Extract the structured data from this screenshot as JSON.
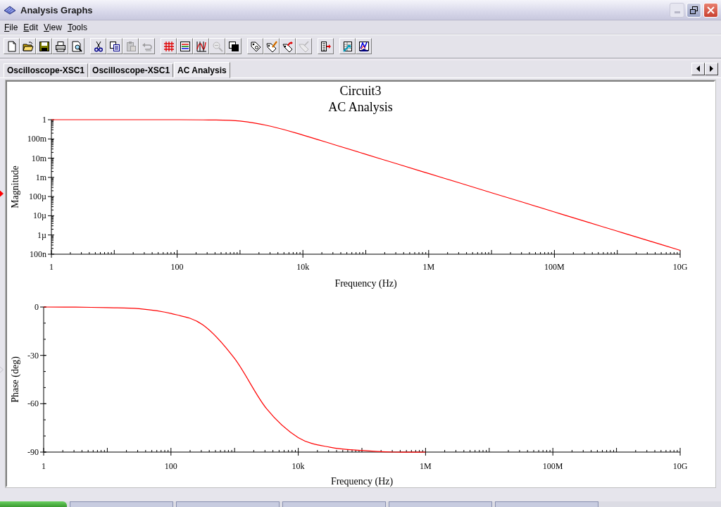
{
  "window": {
    "title": "Analysis Graphs"
  },
  "menu": [
    {
      "label": "File"
    },
    {
      "label": "Edit"
    },
    {
      "label": "View"
    },
    {
      "label": "Tools"
    }
  ],
  "toolbar_groups": [
    [
      {
        "disabled": false
      },
      {
        "disabled": false
      },
      {
        "disabled": false
      },
      {
        "disabled": false
      },
      {
        "disabled": false
      }
    ],
    [
      {
        "disabled": false
      },
      {
        "disabled": false
      },
      {
        "disabled": true
      },
      {
        "disabled": true
      }
    ],
    [
      {
        "disabled": false
      },
      {
        "disabled": false
      },
      {
        "disabled": false
      },
      {
        "disabled": true
      },
      {
        "disabled": false
      }
    ],
    [
      {
        "disabled": false
      },
      {
        "disabled": false
      },
      {
        "disabled": false
      },
      {
        "disabled": true
      }
    ],
    [
      {
        "disabled": false
      }
    ],
    [
      {
        "disabled": false
      },
      {
        "disabled": false
      }
    ]
  ],
  "tabs": [
    {
      "label": "Oscilloscope-XSC1",
      "selected": false
    },
    {
      "label": "Oscilloscope-XSC1",
      "selected": false
    },
    {
      "label": "AC Analysis",
      "selected": true
    }
  ],
  "graph_title": [
    "Circuit3",
    "AC Analysis"
  ],
  "graphs": [
    {
      "selected": true,
      "kind": "magnitude_plot",
      "xlabel": "Frequency (Hz)",
      "ylabel": "Magnitude",
      "y_axis_labels": [
        "1",
        "100m",
        "10m",
        "1m",
        "100µ",
        "10µ",
        "1µ",
        "100n"
      ],
      "x_axis_labels": [
        "1",
        "100",
        "10k",
        "1M",
        "100M",
        "10G"
      ]
    },
    {
      "selected": false,
      "chart_data": {
        "type": "line",
        "xlabel": "Frequency (Hz)",
        "ylabel": "Phase (deg)",
        "ylim": [
          -90,
          0
        ],
        "categories": [
          "1",
          null,
          null,
          null,
          "100",
          null,
          null,
          null,
          "10k",
          null,
          null,
          null,
          "1M",
          null,
          null,
          null,
          "100M",
          null,
          null,
          null,
          "10G"
        ],
        "series": [
          {
            "color": "#ff0000",
            "values": [
              0,
              -0.1,
              -0.4,
              -1,
              -4,
              -11,
              -32,
              -63,
              -81,
              -87,
              -89,
              -90,
              -90,
              null,
              null,
              null,
              null,
              null,
              null,
              null,
              null
            ]
          }
        ],
        "yticks": [
          0,
          -30,
          -60,
          -90
        ]
      }
    }
  ]
}
